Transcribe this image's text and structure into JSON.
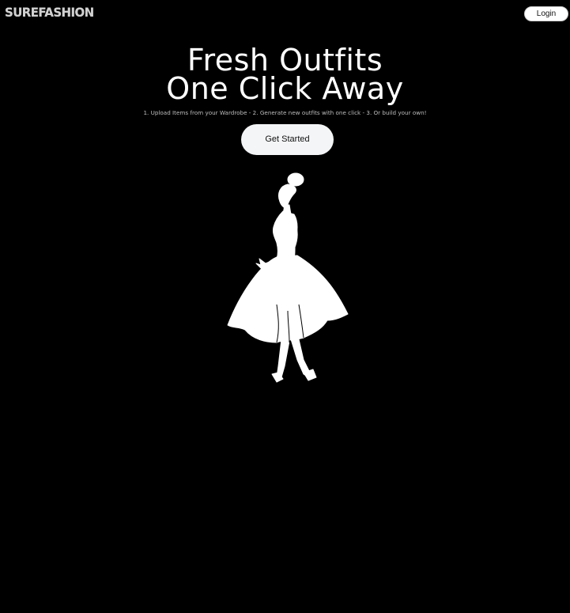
{
  "header": {
    "logo_text": "SUREFASHION",
    "login_label": "Login"
  },
  "hero": {
    "title_line1": "Fresh Outfits",
    "title_line2": "One Click Away",
    "subtitle": "1. Upload Items from your Wardrobe - 2. Generate new outfits with one click - 3. Or build your own!",
    "cta_label": "Get Started"
  },
  "illustration": {
    "icon": "woman-in-dress-silhouette-icon"
  },
  "colors": {
    "background": "#000000",
    "text": "#ffffff",
    "button_bg": "#f4f5f7",
    "button_text": "#111111",
    "subtitle": "#bdbdbd"
  }
}
